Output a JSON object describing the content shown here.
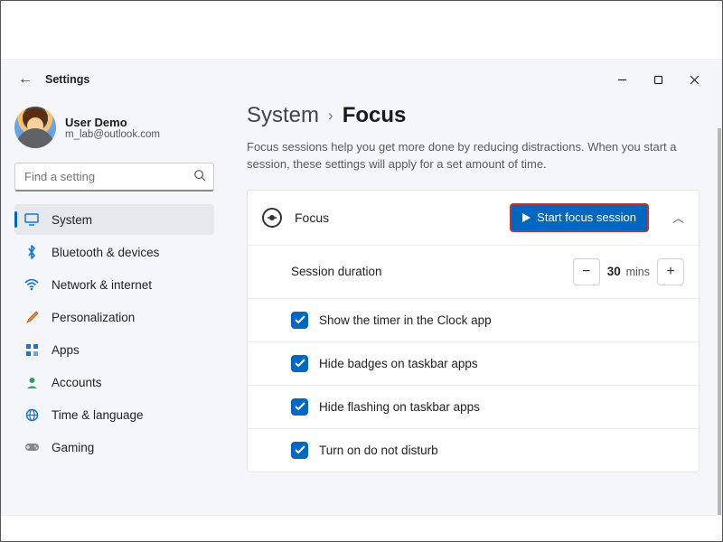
{
  "app_title": "Settings",
  "user": {
    "name": "User Demo",
    "email": "m_lab@outlook.com"
  },
  "search": {
    "placeholder": "Find a setting"
  },
  "sidebar": {
    "items": [
      {
        "label": "System"
      },
      {
        "label": "Bluetooth & devices"
      },
      {
        "label": "Network & internet"
      },
      {
        "label": "Personalization"
      },
      {
        "label": "Apps"
      },
      {
        "label": "Accounts"
      },
      {
        "label": "Time & language"
      },
      {
        "label": "Gaming"
      }
    ]
  },
  "breadcrumb": {
    "parent": "System",
    "leaf": "Focus"
  },
  "description": "Focus sessions help you get more done by reducing distractions. When you start a session, these settings will apply for a set amount of time.",
  "card": {
    "title": "Focus",
    "start_button": "Start focus session",
    "session": {
      "label": "Session duration",
      "value": "30",
      "unit": "mins"
    },
    "options": [
      {
        "label": "Show the timer in the Clock app"
      },
      {
        "label": "Hide badges on taskbar apps"
      },
      {
        "label": "Hide flashing on taskbar apps"
      },
      {
        "label": "Turn on do not disturb"
      }
    ]
  },
  "glyph": {
    "minus": "−",
    "plus": "+",
    "chevron_up": "︿",
    "sep": "›"
  }
}
